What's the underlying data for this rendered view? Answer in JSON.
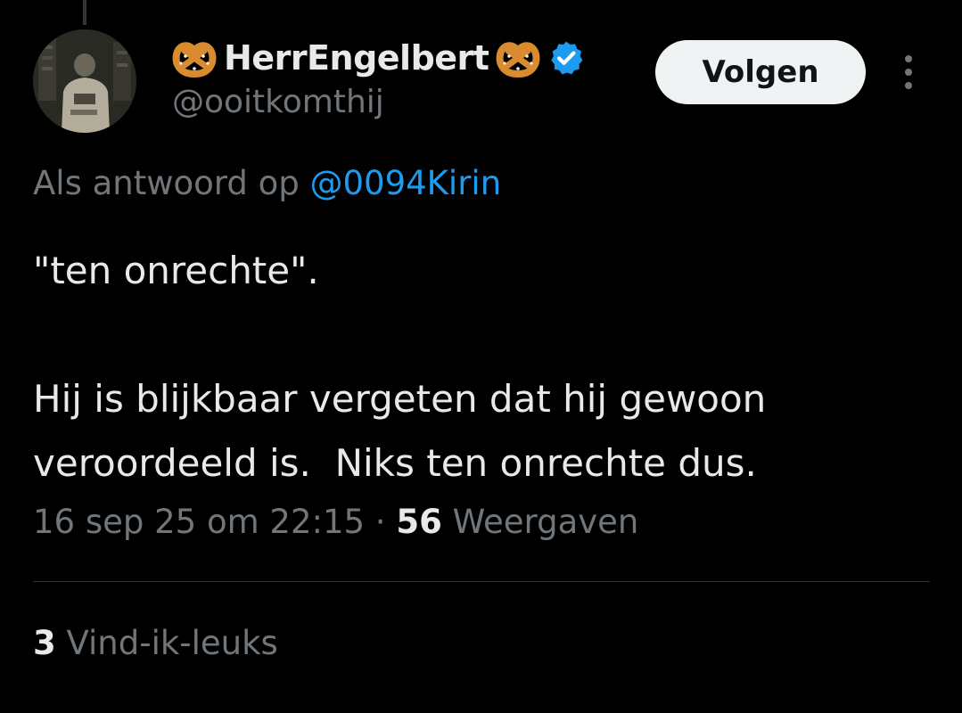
{
  "author": {
    "display_name": "HerrEngelbert",
    "handle": "@ooitkomthij",
    "name_emoji": "pretzel-emoji",
    "verified_color": "#1d9bf0"
  },
  "follow_button": {
    "label": "Volgen"
  },
  "more_button": {
    "icon": "more-vertical-icon"
  },
  "reply": {
    "prefix": "Als antwoord op",
    "mention": "@0094Kirin"
  },
  "tweet": {
    "text": "\"ten onrechte\".\n\nHij is blijkbaar vergeten dat hij gewoon\nveroordeeld is.  Niks ten onrechte dus.",
    "timestamp": "16 sep 25 om 22:15",
    "separator": " · ",
    "views_count": "56",
    "views_label": "Weergaven"
  },
  "engagement": {
    "likes_count": "3",
    "likes_label": "Vind-ik-leuks"
  },
  "colors": {
    "background": "#000000",
    "text_primary": "#e7e9ea",
    "text_secondary": "#71767b",
    "link": "#1d9bf0",
    "divider": "#2f3336",
    "button_bg": "#eff3f4"
  }
}
